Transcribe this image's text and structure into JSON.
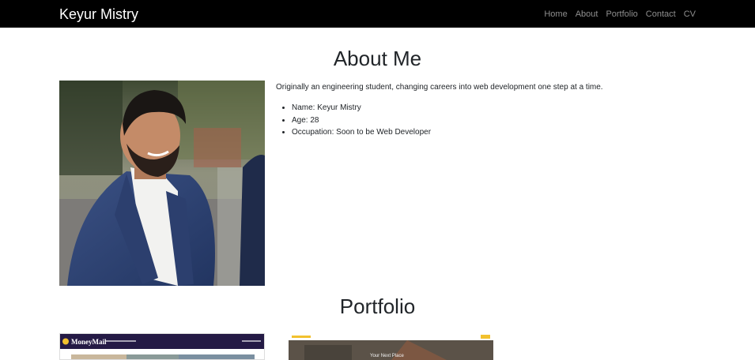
{
  "navbar": {
    "brand": "Keyur Mistry",
    "links": [
      "Home",
      "About",
      "Portfolio",
      "Contact",
      "CV"
    ]
  },
  "about": {
    "heading": "About Me",
    "intro": "Originally an engineering student, changing careers into web development one step at a time.",
    "facts": [
      "Name: Keyur Mistry",
      "Age: 28",
      "Occupation: Soon to be Web Developer"
    ]
  },
  "portfolio": {
    "heading": "Portfolio",
    "projects": [
      {
        "logo_text": "MoneyMail"
      },
      {
        "logo_text": "",
        "hero_text": "Your Next Place"
      }
    ]
  },
  "colors": {
    "navbar_bg": "#000000",
    "nav_link": "#a6a6a6",
    "moneymail_bar": "#241a45",
    "accent_yellow": "#f2c12e"
  },
  "icons": {
    "moneymail_logo": "coin-icon"
  }
}
